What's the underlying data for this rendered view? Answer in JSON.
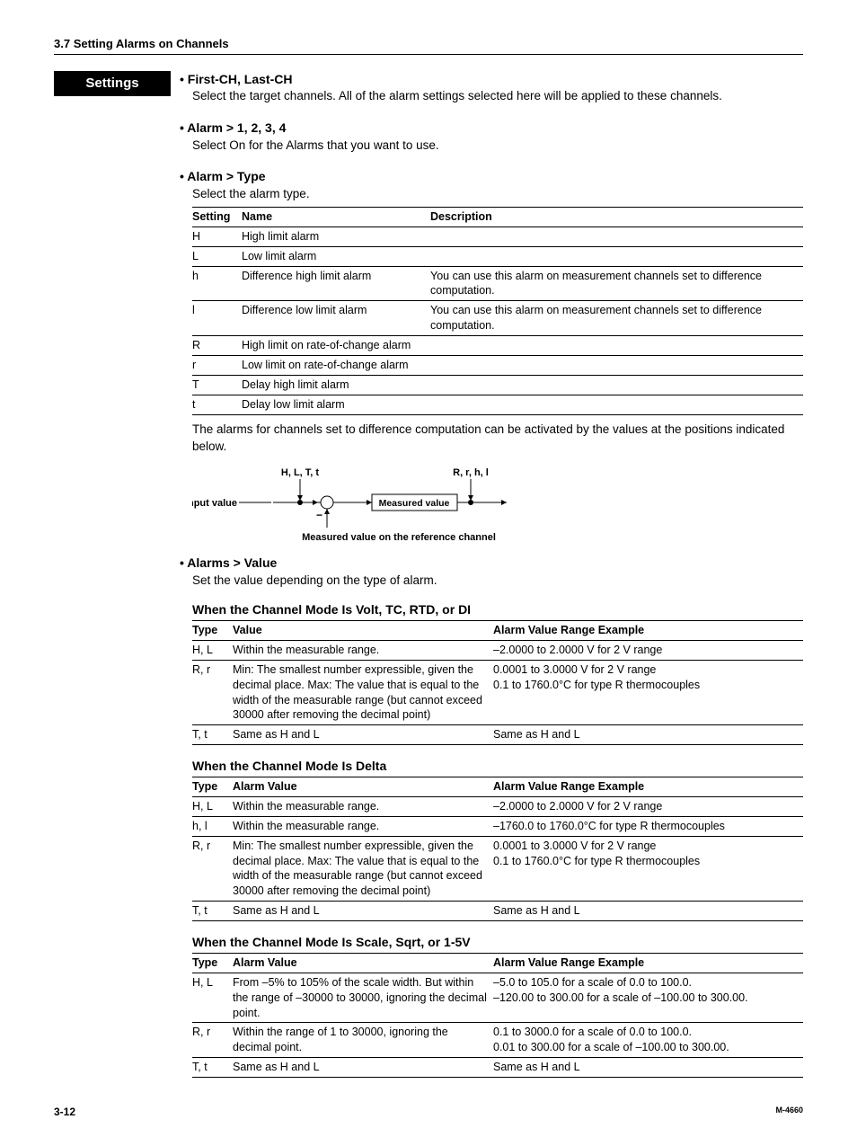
{
  "header": {
    "section_num": "3.7",
    "section_title": "Setting Alarms on Channels",
    "settings_label": "Settings"
  },
  "bullets": {
    "first_last": {
      "title": "First-CH, Last-CH",
      "body": "Select the target channels. All of the alarm settings selected here will be applied to these channels."
    },
    "alarm_nums": {
      "title": "Alarm > 1, 2, 3, 4",
      "body": "Select On for the Alarms that you want to use."
    },
    "alarm_type": {
      "title": "Alarm > Type",
      "body": "Select the alarm type."
    },
    "alarms_value": {
      "title": "Alarms > Value",
      "body": "Set the value depending on the type of alarm."
    }
  },
  "type_table": {
    "headers": [
      "Setting",
      "Name",
      "Description"
    ],
    "rows": [
      {
        "s": "H",
        "n": "High limit alarm",
        "d": ""
      },
      {
        "s": "L",
        "n": "Low limit alarm",
        "d": ""
      },
      {
        "s": "h",
        "n": "Difference high limit alarm",
        "d": "You can use this alarm on measurement channels set to difference computation."
      },
      {
        "s": "l",
        "n": "Difference low limit alarm",
        "d": "You can use this alarm on measurement channels set to difference computation."
      },
      {
        "s": "R",
        "n": "High limit on rate-of-change alarm",
        "d": ""
      },
      {
        "s": "r",
        "n": "Low limit on rate-of-change alarm",
        "d": ""
      },
      {
        "s": "T",
        "n": "Delay high limit alarm",
        "d": ""
      },
      {
        "s": "t",
        "n": "Delay low limit alarm",
        "d": ""
      }
    ]
  },
  "diff_note": "The alarms for channels set to difference computation can be activated by the values at the positions indicated below.",
  "diagram": {
    "left_label": "H, L, T, t",
    "right_label": "R, r, h, l",
    "input": "Input value",
    "measured_box": "Measured value",
    "minus": "−",
    "caption": "Measured value on the reference channel"
  },
  "mode1": {
    "heading": "When the Channel Mode Is Volt, TC, RTD, or DI",
    "headers": [
      "Type",
      "Value",
      "Alarm Value Range Example"
    ],
    "rows": [
      {
        "t": "H, L",
        "v": "Within the measurable range.",
        "e": "–2.0000 to 2.0000 V for 2 V range"
      },
      {
        "t": "R, r",
        "v": "Min: The smallest number expressible, given the decimal place. Max: The value that is equal to the width of the measurable range (but cannot exceed 30000 after removing the decimal point)",
        "e": "0.0001 to 3.0000 V for 2 V range\n0.1 to 1760.0°C for type R thermocouples"
      },
      {
        "t": "T, t",
        "v": "Same as H and L",
        "e": "Same as H and L"
      }
    ]
  },
  "mode2": {
    "heading": "When the Channel Mode Is Delta",
    "headers": [
      "Type",
      "Alarm Value",
      "Alarm Value Range Example"
    ],
    "rows": [
      {
        "t": "H, L",
        "v": "Within the measurable range.",
        "e": "–2.0000 to 2.0000 V for 2 V range"
      },
      {
        "t": "h, l",
        "v": "Within the measurable range.",
        "e": "–1760.0 to 1760.0°C for type R thermocouples"
      },
      {
        "t": "R, r",
        "v": "Min: The smallest number expressible, given the decimal place. Max: The value that is equal to the width of the measurable range (but cannot exceed 30000 after removing the decimal point)",
        "e": "0.0001 to 3.0000 V for 2 V range\n0.1 to 1760.0°C for type R thermocouples"
      },
      {
        "t": "T, t",
        "v": "Same as H and L",
        "e": "Same as H and L"
      }
    ]
  },
  "mode3": {
    "heading": "When the Channel Mode Is Scale, Sqrt, or 1-5V",
    "headers": [
      "Type",
      "Alarm Value",
      "Alarm Value Range Example"
    ],
    "rows": [
      {
        "t": "H, L",
        "v": "From –5% to 105% of the scale width. But within the range of –30000 to 30000, ignoring the decimal point.",
        "e": "–5.0 to 105.0 for a scale of 0.0 to 100.0.\n–120.00 to 300.00 for a scale of –100.00 to 300.00."
      },
      {
        "t": "R, r",
        "v": "Within the range of 1 to 30000, ignoring the decimal point.",
        "e": "0.1 to 3000.0 for a scale of 0.0 to 100.0.\n0.01 to 300.00 for a scale of –100.00 to 300.00."
      },
      {
        "t": "T, t",
        "v": "Same as H and L",
        "e": "Same as H and L"
      }
    ]
  },
  "footer": {
    "page": "3-12",
    "docid": "M-4660"
  }
}
